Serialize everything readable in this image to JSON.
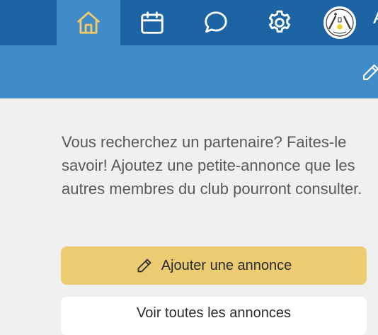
{
  "nav": {
    "items": [
      {
        "icon": "home-icon",
        "active": true
      },
      {
        "icon": "calendar-icon",
        "active": false
      },
      {
        "icon": "chat-icon",
        "active": false
      },
      {
        "icon": "gear-icon",
        "active": false
      },
      {
        "icon": "club-logo-avatar",
        "active": false
      }
    ],
    "user_initial": "A"
  },
  "subbar": {
    "icon": "edit-icon"
  },
  "main": {
    "intro": "Vous recherchez un partenaire? Faites-le savoir! Ajoutez une petite-annonce que les autres membres du club pourront consulter.",
    "add_button_label": "Ajouter une annonce",
    "add_button_icon": "pencil-icon",
    "second_button_label": "Voir toutes les annonces"
  },
  "colors": {
    "nav_bg": "#1c64a4",
    "nav_active": "#3f8cc9",
    "subbar_bg": "#3f8cc9",
    "accent_yellow": "#ebcc72",
    "page_bg": "#f0f0f0"
  }
}
